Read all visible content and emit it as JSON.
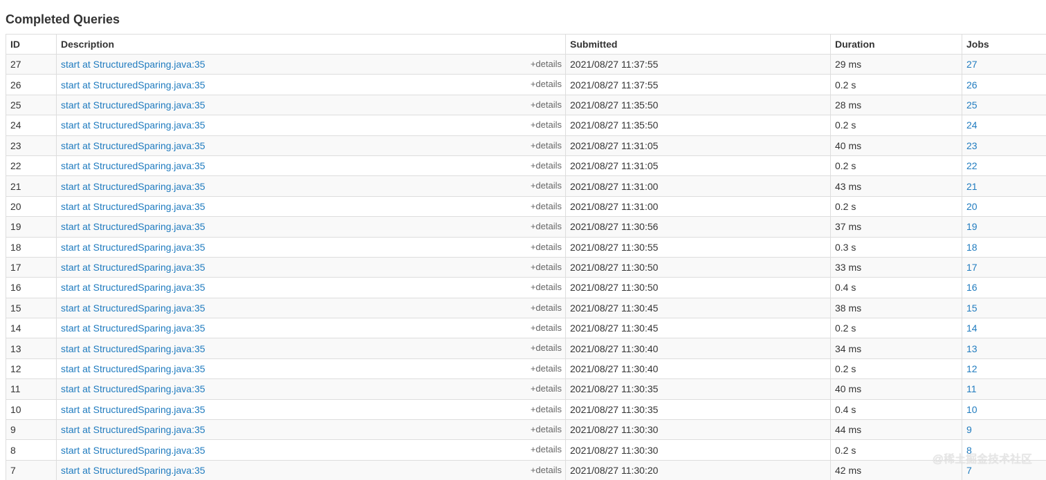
{
  "section_title": "Completed Queries",
  "columns": [
    "ID",
    "Description",
    "Submitted",
    "Duration",
    "Jobs"
  ],
  "details_label": "+details",
  "watermark": "@稀土掘金技术社区",
  "rows": [
    {
      "id": "27",
      "description": "start at StructuredSparing.java:35",
      "submitted": "2021/08/27 11:37:55",
      "duration": "29 ms",
      "jobs": "27"
    },
    {
      "id": "26",
      "description": "start at StructuredSparing.java:35",
      "submitted": "2021/08/27 11:37:55",
      "duration": "0.2 s",
      "jobs": "26"
    },
    {
      "id": "25",
      "description": "start at StructuredSparing.java:35",
      "submitted": "2021/08/27 11:35:50",
      "duration": "28 ms",
      "jobs": "25"
    },
    {
      "id": "24",
      "description": "start at StructuredSparing.java:35",
      "submitted": "2021/08/27 11:35:50",
      "duration": "0.2 s",
      "jobs": "24"
    },
    {
      "id": "23",
      "description": "start at StructuredSparing.java:35",
      "submitted": "2021/08/27 11:31:05",
      "duration": "40 ms",
      "jobs": "23"
    },
    {
      "id": "22",
      "description": "start at StructuredSparing.java:35",
      "submitted": "2021/08/27 11:31:05",
      "duration": "0.2 s",
      "jobs": "22"
    },
    {
      "id": "21",
      "description": "start at StructuredSparing.java:35",
      "submitted": "2021/08/27 11:31:00",
      "duration": "43 ms",
      "jobs": "21"
    },
    {
      "id": "20",
      "description": "start at StructuredSparing.java:35",
      "submitted": "2021/08/27 11:31:00",
      "duration": "0.2 s",
      "jobs": "20"
    },
    {
      "id": "19",
      "description": "start at StructuredSparing.java:35",
      "submitted": "2021/08/27 11:30:56",
      "duration": "37 ms",
      "jobs": "19"
    },
    {
      "id": "18",
      "description": "start at StructuredSparing.java:35",
      "submitted": "2021/08/27 11:30:55",
      "duration": "0.3 s",
      "jobs": "18"
    },
    {
      "id": "17",
      "description": "start at StructuredSparing.java:35",
      "submitted": "2021/08/27 11:30:50",
      "duration": "33 ms",
      "jobs": "17"
    },
    {
      "id": "16",
      "description": "start at StructuredSparing.java:35",
      "submitted": "2021/08/27 11:30:50",
      "duration": "0.4 s",
      "jobs": "16"
    },
    {
      "id": "15",
      "description": "start at StructuredSparing.java:35",
      "submitted": "2021/08/27 11:30:45",
      "duration": "38 ms",
      "jobs": "15"
    },
    {
      "id": "14",
      "description": "start at StructuredSparing.java:35",
      "submitted": "2021/08/27 11:30:45",
      "duration": "0.2 s",
      "jobs": "14"
    },
    {
      "id": "13",
      "description": "start at StructuredSparing.java:35",
      "submitted": "2021/08/27 11:30:40",
      "duration": "34 ms",
      "jobs": "13"
    },
    {
      "id": "12",
      "description": "start at StructuredSparing.java:35",
      "submitted": "2021/08/27 11:30:40",
      "duration": "0.2 s",
      "jobs": "12"
    },
    {
      "id": "11",
      "description": "start at StructuredSparing.java:35",
      "submitted": "2021/08/27 11:30:35",
      "duration": "40 ms",
      "jobs": "11"
    },
    {
      "id": "10",
      "description": "start at StructuredSparing.java:35",
      "submitted": "2021/08/27 11:30:35",
      "duration": "0.4 s",
      "jobs": "10"
    },
    {
      "id": "9",
      "description": "start at StructuredSparing.java:35",
      "submitted": "2021/08/27 11:30:30",
      "duration": "44 ms",
      "jobs": "9"
    },
    {
      "id": "8",
      "description": "start at StructuredSparing.java:35",
      "submitted": "2021/08/27 11:30:30",
      "duration": "0.2 s",
      "jobs": "8"
    },
    {
      "id": "7",
      "description": "start at StructuredSparing.java:35",
      "submitted": "2021/08/27 11:30:20",
      "duration": "42 ms",
      "jobs": "7"
    }
  ]
}
